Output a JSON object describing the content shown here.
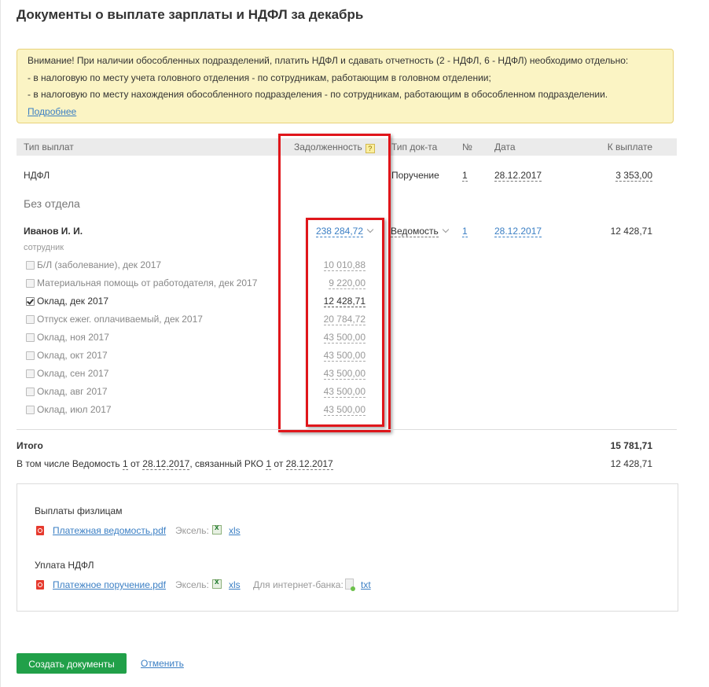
{
  "title": "Документы о выплате зарплаты и НДФЛ за декабрь",
  "warning": {
    "lines": [
      "Внимание! При наличии обособленных подразделений, платить НДФЛ и сдавать отчетность (2 - НДФЛ, 6 - НДФЛ) необходимо отдельно:",
      "- в налоговую по месту учета головного отделения - по сотрудникам, работающим в головном отделении;",
      "- в налоговую по месту нахождения обособленного подразделения - по сотрудникам, работающим в обособленном подразделении."
    ],
    "more_link": "Подробнее"
  },
  "table": {
    "headers": {
      "type": "Тип выплат",
      "debt": "Задолженность",
      "help": "?",
      "doc_type": "Тип док-та",
      "number": "№",
      "date": "Дата",
      "to_pay": "К выплате"
    },
    "ndfl_row": {
      "type": "НДФЛ",
      "doc_type": "Поручение",
      "number": "1",
      "date": "28.12.2017",
      "to_pay": "3 353,00"
    },
    "section": "Без отдела",
    "employee": {
      "name": "Иванов И. И.",
      "role": "сотрудник",
      "debt": "238 284,72",
      "doc_type": "Ведомость",
      "number": "1",
      "date": "28.12.2017",
      "to_pay": "12 428,71"
    },
    "items": [
      {
        "label": "Б/Л (заболевание), дек 2017",
        "amount": "10 010,88",
        "checked": false
      },
      {
        "label": "Материальная помощь от работодателя, дек 2017",
        "amount": "9 220,00",
        "checked": false
      },
      {
        "label": "Оклад, дек 2017",
        "amount": "12 428,71",
        "checked": true
      },
      {
        "label": "Отпуск ежег. оплачиваемый, дек 2017",
        "amount": "20 784,72",
        "checked": false
      },
      {
        "label": "Оклад, ноя 2017",
        "amount": "43 500,00",
        "checked": false
      },
      {
        "label": "Оклад, окт 2017",
        "amount": "43 500,00",
        "checked": false
      },
      {
        "label": "Оклад, сен 2017",
        "amount": "43 500,00",
        "checked": false
      },
      {
        "label": "Оклад, авг 2017",
        "amount": "43 500,00",
        "checked": false
      },
      {
        "label": "Оклад, июл 2017",
        "amount": "43 500,00",
        "checked": false
      }
    ]
  },
  "totals": {
    "label": "Итого",
    "value": "15 781,71",
    "detail": {
      "p1": "В том числе Ведомость ",
      "num1": "1",
      "p2": " от ",
      "date1": "28.12.2017",
      "p3": ", связанный РКО ",
      "num2": "1",
      "p4": " от ",
      "date2": "28.12.2017"
    },
    "detail_value": "12 428,71"
  },
  "docs": {
    "group1_title": "Выплаты физлицам",
    "group1_pdf": "Платежная ведомость.pdf",
    "group2_title": "Уплата НДФЛ",
    "group2_pdf": "Платежное поручение.pdf",
    "excel_label": "Эксель:",
    "xls": "xls",
    "bank_label": "Для интернет-банка:",
    "txt": "txt"
  },
  "actions": {
    "create": "Создать документы",
    "cancel": "Отменить"
  },
  "colors": {
    "primary_button": "#21a049",
    "link": "#3b7fc4",
    "warning_bg": "#fbf4c4",
    "highlight": "#e0161b"
  },
  "icons": [
    "help-icon",
    "chevron-down-icon",
    "checkbox-icon",
    "pdf-icon",
    "excel-icon",
    "txt-file-icon"
  ]
}
